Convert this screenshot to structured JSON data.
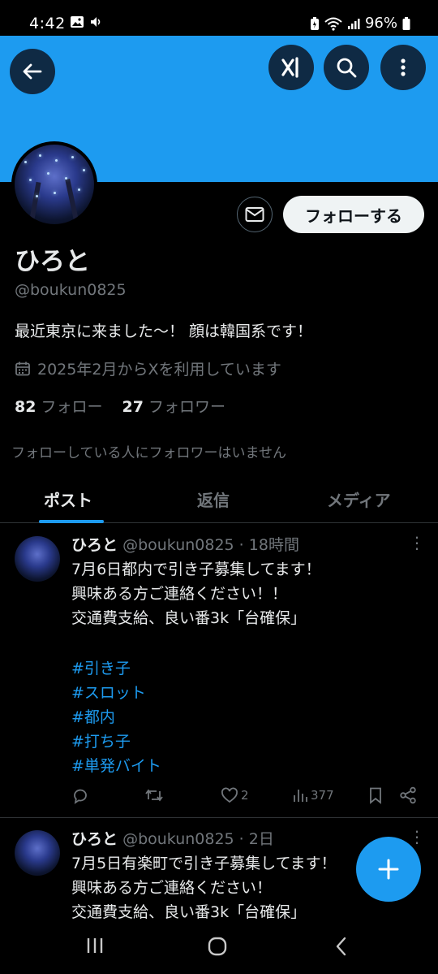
{
  "status_bar": {
    "time": "4:42",
    "battery": "96%"
  },
  "profile": {
    "display_name": "ひろと",
    "handle": "@boukun0825",
    "bio": "最近東京に来ました〜！ 顔は韓国系です！",
    "joined": "2025年2月からXを利用しています",
    "following_count": "82",
    "following_label": "フォロー",
    "followers_count": "27",
    "followers_label": "フォロワー",
    "no_mutual": "フォローしている人にフォロワーはいません",
    "follow_button": "フォローする"
  },
  "tabs": [
    {
      "label": "ポスト",
      "active": true
    },
    {
      "label": "返信",
      "active": false
    },
    {
      "label": "メディア",
      "active": false
    }
  ],
  "posts": [
    {
      "name": "ひろと",
      "meta": "@boukun0825 · 18時間",
      "lines": [
        "7月6日都内で引き子募集してます！",
        "興味ある方ご連絡ください！！",
        "交通費支給、良い番3k「台確保」"
      ],
      "tags": [
        "#引き子",
        "#スロット",
        "#都内",
        "#打ち子",
        "#単発バイト"
      ],
      "likes": "2",
      "views": "377"
    },
    {
      "name": "ひろと",
      "meta": "@boukun0825 · 2日",
      "lines": [
        "7月5日有楽町で引き子募集してます！",
        "興味ある方ご連絡ください！",
        "交通費支給、良い番3k「台確保」"
      ]
    }
  ],
  "icons": {
    "back": "back-arrow-icon",
    "grok": "grok-icon",
    "search": "search-icon",
    "more": "more-vertical-icon",
    "mail": "mail-icon",
    "calendar": "calendar-icon",
    "compose": "plus-icon"
  },
  "colors": {
    "accent": "#1d9bf0",
    "background": "#000000",
    "muted": "#71767b",
    "text": "#e7e9ea"
  }
}
